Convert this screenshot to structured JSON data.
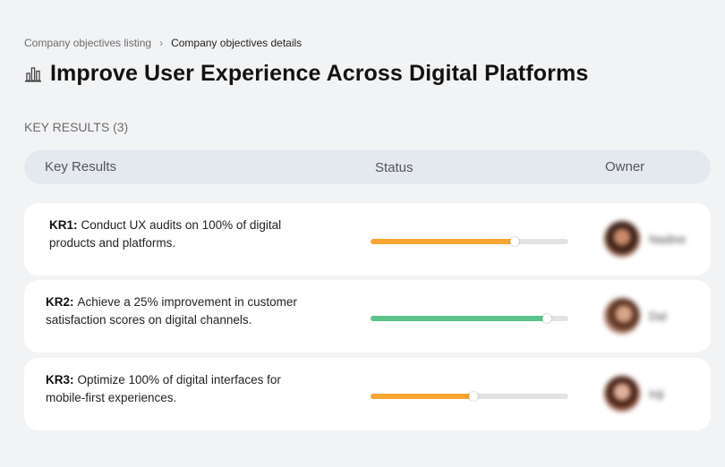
{
  "breadcrumb": {
    "items": [
      "Company objectives listing",
      "Company objectives details"
    ],
    "separator": "›"
  },
  "page": {
    "title": "Improve User Experience Across Digital Platforms",
    "title_icon": "building-chart-icon"
  },
  "section": {
    "label": "KEY RESULTS (3)"
  },
  "table": {
    "headers": {
      "key_results": "Key Results",
      "status": "Status",
      "owner": "Owner"
    }
  },
  "colors": {
    "orange": "#f9a533",
    "green": "#5bc48b"
  },
  "key_results": [
    {
      "id": "KR1:",
      "text": "Conduct UX audits on 100% of digital products and platforms.",
      "progress": 0.73,
      "color": "#f9a533",
      "owner": "Nadine"
    },
    {
      "id": "KR2:",
      "text": "Achieve a 25% improvement in customer satisfaction scores on digital channels.",
      "progress": 0.89,
      "color": "#5bc48b",
      "owner": "Dal"
    },
    {
      "id": "KR3:",
      "text": "Optimize 100% of digital interfaces for mobile-first experiences.",
      "progress": 0.52,
      "color": "#f9a533",
      "owner": "Inji"
    }
  ]
}
